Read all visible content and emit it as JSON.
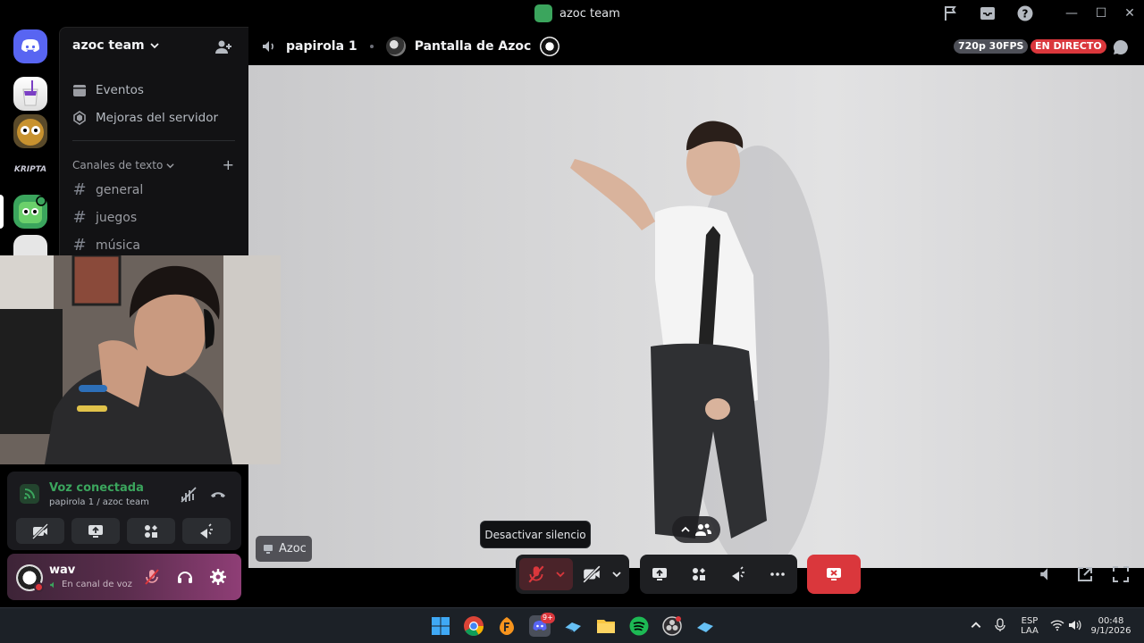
{
  "window": {
    "title": "azoc team"
  },
  "sidebar": {
    "server_name": "azoc team",
    "items": [
      {
        "label": "Eventos",
        "icon": "calendar-icon"
      },
      {
        "label": "Mejoras del servidor",
        "icon": "boost-icon"
      }
    ],
    "category": "Canales de texto",
    "channels": [
      "general",
      "juegos",
      "música"
    ]
  },
  "header": {
    "voice_channel": "papirola 1",
    "stream_title": "Pantalla de Azoc",
    "quality": "720p 30FPS",
    "live": "EN DIRECTO"
  },
  "stage": {
    "streamer_label": "Azoc"
  },
  "voice": {
    "status": "Voz conectada",
    "location": "papirola 1 / azoc team"
  },
  "user": {
    "name": "wav",
    "status": "En canal de voz"
  },
  "controls": {
    "tooltip": "Desactivar silencio"
  },
  "taskbar": {
    "lang_top": "ESP",
    "lang_bottom": "LAA",
    "time": "00:48",
    "date": "9/1/2026",
    "discord_badge": "9+"
  },
  "colors": {
    "accent_green": "#3ba55d",
    "live_red": "#da373c",
    "discord_blurple": "#5865f2"
  }
}
